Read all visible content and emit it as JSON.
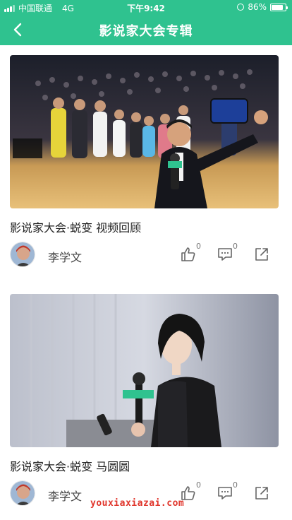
{
  "status_bar": {
    "carrier": "中国联通",
    "network": "4G",
    "time": "下午9:42",
    "battery": "86%",
    "battery_level": 0.86
  },
  "nav": {
    "title": "影说家大会专辑",
    "back_icon": "chevron-left-icon"
  },
  "theme": {
    "header_color": "#2fc28f",
    "watermark_color": "#e0362c"
  },
  "videos": [
    {
      "title": "影说家大会·蜕变 视频回顾",
      "author": "李学文",
      "likes": "0",
      "comments": "0",
      "thumbnail": "group-selfie-on-stage"
    },
    {
      "title": "影说家大会·蜕变 马圆圆",
      "author": "李学文",
      "likes": "0",
      "comments": "0",
      "thumbnail": "speaker-with-microphone"
    }
  ],
  "watermark": "youxiaxiazai.com"
}
